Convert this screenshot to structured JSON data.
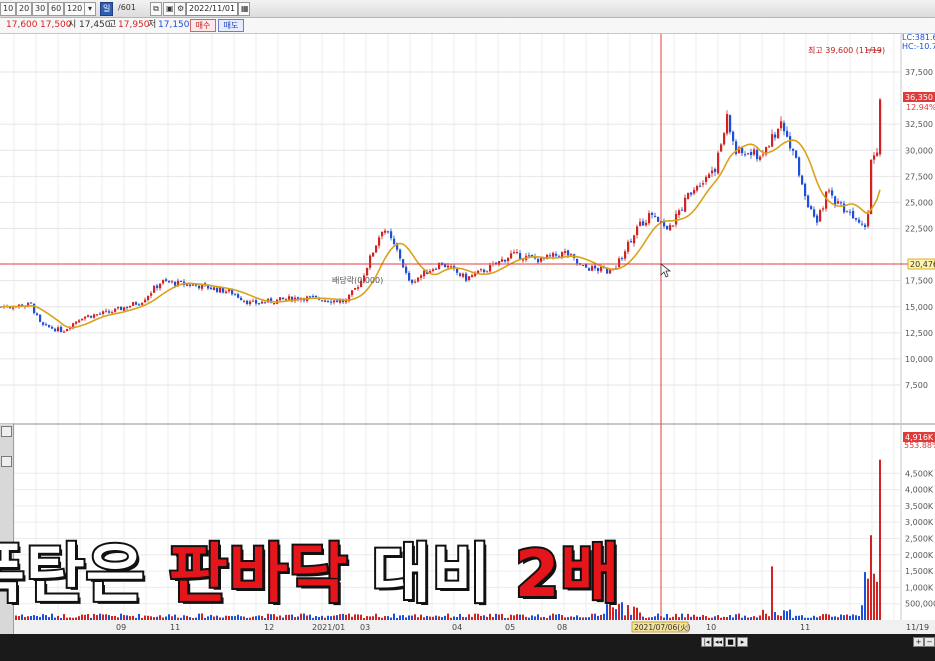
{
  "toolbar": {
    "period_buttons": [
      "10",
      "20",
      "30",
      "60",
      "120"
    ],
    "mode_active": "일",
    "mode_other": "/601",
    "date": "2022/11/01"
  },
  "info": {
    "price1": "17,600",
    "price2": "17,500",
    "open_label": "시",
    "open": "17,450",
    "high_label": "고",
    "high": "17,950",
    "low_label": "저",
    "low": "17,150",
    "buy": "매수",
    "sell": "매도"
  },
  "price_panel": {
    "header_lc": "LC:381.6",
    "header_hc": "HC:-10.7",
    "max_annotation": "최고 39,600 (11/19)",
    "event_annotation": "배당락(0.000)",
    "current_price": "36,350",
    "current_pct": "12.94%",
    "crosshair_price": "20,476",
    "y_ticks": [
      "37,500",
      "32,500",
      "30,000",
      "27,500",
      "25,000",
      "22,500",
      "17,500",
      "15,000",
      "12,500",
      "10,000",
      "7,500"
    ]
  },
  "volume_panel": {
    "current_volume": "4,916K",
    "volume_pct": "553.88%",
    "y_ticks": [
      "4,500K",
      "4,000K",
      "3,500K",
      "3,000K",
      "2,500K",
      "2,000K",
      "1,500K",
      "1,000K",
      "500,000"
    ]
  },
  "x_axis": {
    "labels": [
      "09",
      "11",
      "12",
      "2021/01",
      "03",
      "04",
      "05",
      "08",
      "10",
      "11"
    ],
    "crosshair_date": "2021/07/06(火)",
    "last_label": "11/19"
  },
  "caption": {
    "part1": "폭탄은",
    "part2": "판바닥",
    "part3": "대비",
    "part4": "2배"
  },
  "colors": {
    "up": "#d32222",
    "down": "#1e4fd8",
    "moving_average": "#d9a21b",
    "crosshair": "#e23c3c"
  }
}
